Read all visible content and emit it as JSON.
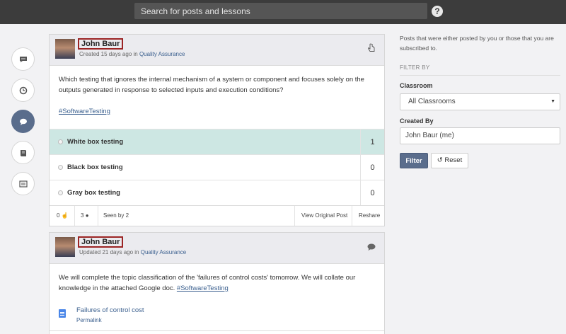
{
  "search": {
    "placeholder": "Search for posts and lessons"
  },
  "help": {
    "symbol": "?"
  },
  "nav": [
    "comments-icon",
    "clock-icon",
    "chat-icon",
    "book-icon",
    "list-icon"
  ],
  "post1": {
    "author": "John Baur",
    "meta_prefix": "Created 15 days ago in ",
    "meta_link": "Quality Assurance",
    "question": "Which testing that ignores the internal mechanism of a system or component and focuses solely on the outputs generated in response to selected inputs and execution conditions?",
    "tag": "#SoftwareTesting",
    "options": [
      {
        "label": "White box testing",
        "count": "1",
        "selected": true
      },
      {
        "label": "Black box testing",
        "count": "0",
        "selected": false
      },
      {
        "label": "Gray box testing",
        "count": "0",
        "selected": false
      }
    ],
    "likes": "0",
    "comments": "3",
    "seen": "Seen by 2",
    "view_original": "View Original Post",
    "reshare": "Reshare"
  },
  "post2": {
    "author": "John Baur",
    "meta_prefix": "Updated 21 days ago in ",
    "meta_link": "Quality Assurance",
    "text": "We will complete the topic classification of the 'failures of control costs' tomorrow. We will collate our knowledge in the attached Google doc. ",
    "tag": "#SoftwareTesting",
    "attachment_title": "Failures of control cost",
    "attachment_link": "Permalink"
  },
  "sidebar": {
    "description": "Posts that were either posted by you or those that you are subscribed to.",
    "filter_by": "FILTER BY",
    "classroom_label": "Classroom",
    "classroom_value": "All Classrooms",
    "created_by_label": "Created By",
    "created_by_value": "John Baur (me)",
    "filter_button": "Filter",
    "reset_button": "Reset"
  },
  "colors": {
    "accent": "#5a6d8c",
    "selected_option": "#cde7e3",
    "topbar": "#3c3c3c",
    "highlight_border": "#9b2424"
  }
}
